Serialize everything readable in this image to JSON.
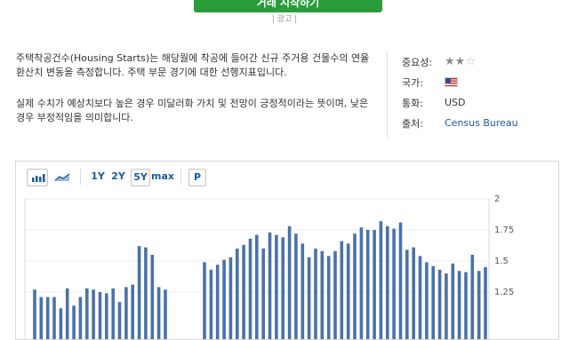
{
  "cta": {
    "label": "거래 시작하기"
  },
  "ad": {
    "label": "| 광고 |"
  },
  "description": {
    "p1": "주택착공건수(Housing Starts)는 해당월에 착공에 들어간 신규 주거용 건물수의 연율환산치 변동을 측정합니다. 주택 부문 경기에 대한 선행지표입니다.",
    "p2": "실제 수치가 예상치보다 높은 경우 미달러화 가치 및 전망이 긍정적이라는 뜻이며, 낮은 경우 부정적임을 의미합니다."
  },
  "meta": {
    "importance_label": "중요성:",
    "importance_stars": 2,
    "importance_max": 3,
    "country_label": "국가:",
    "currency_label": "통화:",
    "currency_value": "USD",
    "source_label": "출처:",
    "source_value": "Census Bureau"
  },
  "toolbar": {
    "range_1y": "1Y",
    "range_2y": "2Y",
    "range_5y": "5Y",
    "range_max": "max",
    "p_label": "P",
    "selected": "5Y"
  },
  "colors": {
    "bar": "#4a72a8",
    "accent": "#2a9d3a",
    "link": "#1a5aa0"
  },
  "chart_data": {
    "type": "bar",
    "y_ticks": [
      1.25,
      1.5,
      1.75,
      2
    ],
    "ylim": [
      1.0,
      2.0
    ],
    "values": [
      1.27,
      1.21,
      1.21,
      1.21,
      1.12,
      1.28,
      1.14,
      1.21,
      1.28,
      1.27,
      1.25,
      1.24,
      1.28,
      1.17,
      1.29,
      1.31,
      1.62,
      1.61,
      1.55,
      1.29,
      1.27,
      1.0,
      1.0,
      1.0,
      1.0,
      1.0,
      1.49,
      1.43,
      1.47,
      1.51,
      1.53,
      1.6,
      1.63,
      1.68,
      1.71,
      1.6,
      1.73,
      1.71,
      1.69,
      1.78,
      1.72,
      1.64,
      1.53,
      1.6,
      1.58,
      1.54,
      1.58,
      1.66,
      1.64,
      1.72,
      1.77,
      1.75,
      1.75,
      1.82,
      1.78,
      1.76,
      1.81,
      1.59,
      1.61,
      1.54,
      1.49,
      1.46,
      1.43,
      1.4,
      1.48,
      1.42,
      1.41,
      1.55,
      1.42,
      1.45
    ]
  }
}
